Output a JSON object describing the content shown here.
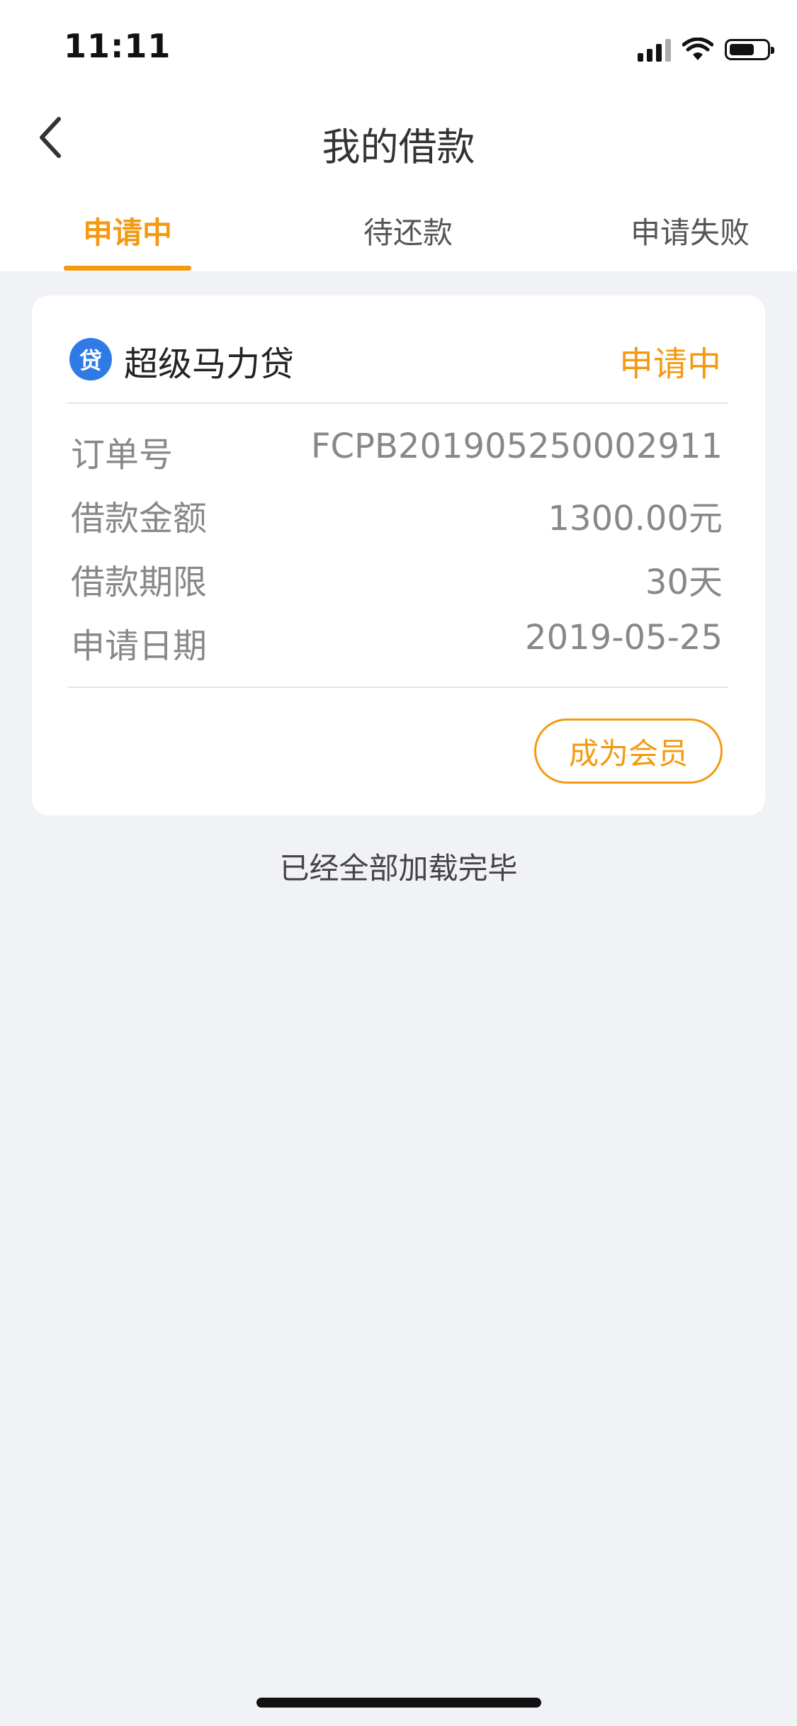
{
  "status_bar": {
    "time": "11:11"
  },
  "header": {
    "title": "我的借款",
    "back_icon": "chevron-left-icon"
  },
  "tabs": [
    {
      "label": "申请中",
      "active": true
    },
    {
      "label": "待还款",
      "active": false
    },
    {
      "label": "申请失败",
      "active": false
    }
  ],
  "loan_card": {
    "logo_text": "贷",
    "product_name": "超级马力贷",
    "status": "申请中",
    "rows": [
      {
        "label": "订单号",
        "value": "FCPB201905250002911"
      },
      {
        "label": "借款金额",
        "value": "1300.00元"
      },
      {
        "label": "借款期限",
        "value": "30天"
      },
      {
        "label": "申请日期",
        "value": "2019-05-25"
      }
    ],
    "action_label": "成为会员"
  },
  "footer_message": "已经全部加载完毕",
  "colors": {
    "accent": "#f39a10",
    "background": "#f1f2f6",
    "logo": "#2f7ae6"
  }
}
